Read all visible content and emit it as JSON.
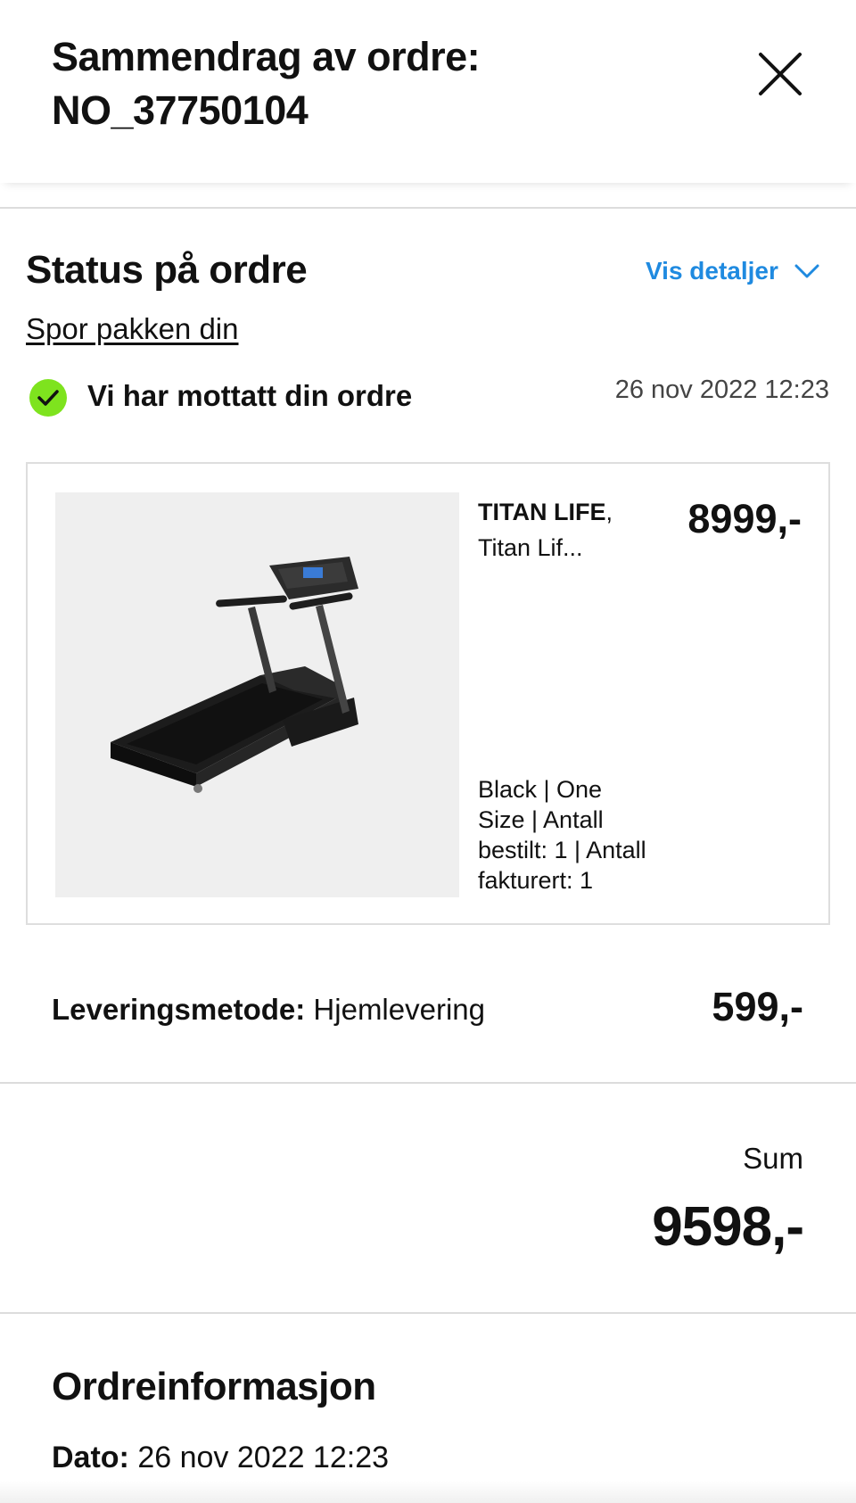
{
  "header": {
    "title_line1": "Sammendrag av ordre:",
    "title_line2": "NO_37750104",
    "close_icon": "close-icon"
  },
  "status": {
    "title": "Status på ordre",
    "details_label": "Vis detaljer",
    "details_icon": "chevron-down-icon",
    "track_label": "Spor pakken din",
    "step_icon": "check-circle-icon",
    "step_text": "Vi har mottatt din ordre",
    "step_time": "26 nov 2022 12:23",
    "step_color": "#7ee31e"
  },
  "product": {
    "image_alt": "treadmill",
    "brand": "TITAN LIFE",
    "name": "Titan Lif...",
    "price": "8999,-",
    "variant_line1": "Black | One",
    "variant_line2": "Size | Antall",
    "variant_line3": "bestilt: 1 | Antall",
    "variant_line4": "fakturert: 1"
  },
  "delivery": {
    "label": "Leveringsmetode:",
    "value": "Hjemlevering",
    "price": "599,-"
  },
  "summary": {
    "label": "Sum",
    "value": "9598,-"
  },
  "order_info": {
    "title": "Ordreinformasjon",
    "date_label": "Dato:",
    "date_value": "26 nov 2022 12:23"
  },
  "colors": {
    "accent_link": "#1f8ae0",
    "success": "#7ee31e",
    "divider": "#dcdcdc"
  }
}
